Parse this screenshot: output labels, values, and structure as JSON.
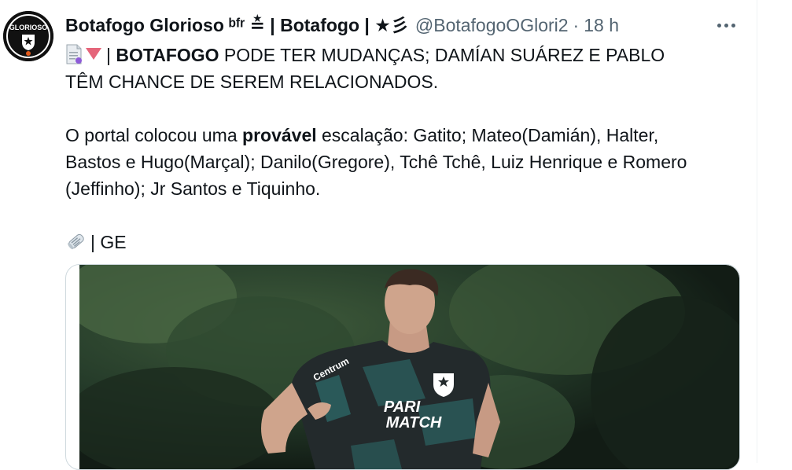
{
  "author": {
    "display_name": "Botafogo Glorioso",
    "name_suffix": "ᵇᶠʳ ≛ | Botafogo | ★彡",
    "handle": "@BotafogoOGlori2",
    "separator": "·",
    "time": "18 h",
    "avatar_text": "GLORIOSO"
  },
  "tweet": {
    "line1_lead": "| ",
    "line1_bold": "BOTAFOGO",
    "line1_rest": " PODE TER MUDANÇAS; DAMÍAN SUÁREZ E PABLO",
    "line2": "TÊM CHANCE DE SEREM RELACIONADOS.",
    "para2_lead": "O portal colocou uma ",
    "para2_bold": "provável",
    "para2_rest_line1": " escalação: Gatito; Mateo(Damián), Halter,",
    "para2_line2": "Bastos e Hugo(Marçal); Danilo(Gregore), Tchê Tchê, Luiz Henrique e Romero",
    "para2_line3": "(Jeffinho); Jr Santos e Tiquinho.",
    "source_text": "| GE"
  },
  "media": {
    "jersey_sponsor": "PARI MATCH",
    "jersey_sponsor_line1": "PARI",
    "jersey_sponsor_line2": "MATCH",
    "sleeve_sponsor": "Centrum"
  },
  "icons": {
    "more": "more-horizontal-icon",
    "doc_emoji": "page-facing-up-emoji",
    "triangle_emoji": "red-triangle-down-emoji",
    "news_emoji": "rolled-newspaper-emoji"
  },
  "colors": {
    "text": "#0f1419",
    "secondary": "#536471",
    "border": "#cfd9de",
    "triangle": "#e5657a"
  }
}
